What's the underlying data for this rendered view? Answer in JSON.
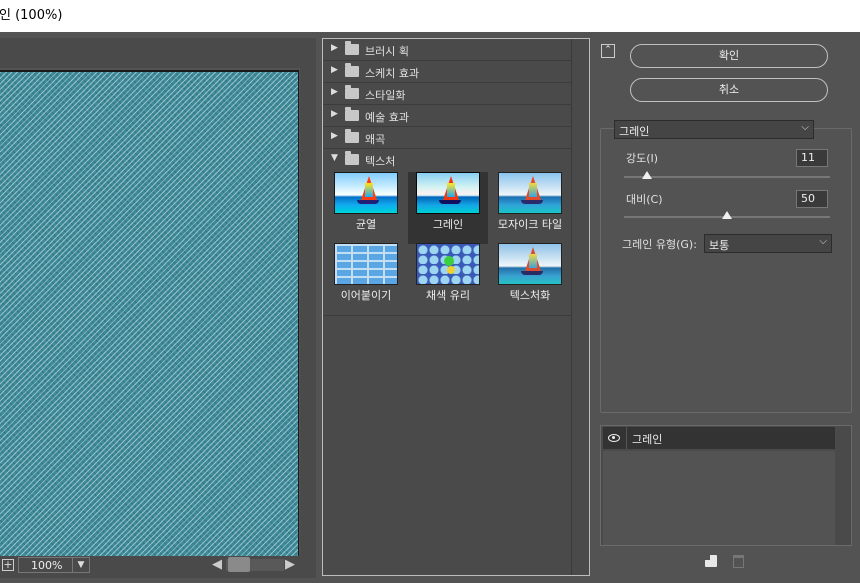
{
  "window": {
    "title": "인 (100%)"
  },
  "preview": {
    "zoom": "100%"
  },
  "gallery": {
    "categories": [
      {
        "label": "브러시 획",
        "expanded": false
      },
      {
        "label": "스케치 효과",
        "expanded": false
      },
      {
        "label": "스타일화",
        "expanded": false
      },
      {
        "label": "예술 효과",
        "expanded": false
      },
      {
        "label": "왜곡",
        "expanded": false
      },
      {
        "label": "텍스처",
        "expanded": true
      }
    ],
    "thumbnails": [
      {
        "label": "균열",
        "selected": false
      },
      {
        "label": "그레인",
        "selected": true
      },
      {
        "label": "모자이크 타일",
        "selected": false
      },
      {
        "label": "이어붙이기",
        "selected": false
      },
      {
        "label": "채색 유리",
        "selected": false
      },
      {
        "label": "텍스처화",
        "selected": false
      }
    ]
  },
  "buttons": {
    "ok": "확인",
    "cancel": "취소"
  },
  "settings": {
    "filter": "그레인",
    "intensity_label": "강도(I)",
    "intensity_value": "11",
    "intensity_fraction": 0.11,
    "contrast_label": "대비(C)",
    "contrast_value": "50",
    "contrast_fraction": 0.5,
    "grain_type_label": "그레인 유형(G):",
    "grain_type_value": "보통"
  },
  "layers": [
    {
      "name": "그레인",
      "visible": true
    }
  ],
  "colors": {
    "panel": "#535353",
    "selected": "#333333",
    "preview": "#3f8a99"
  }
}
